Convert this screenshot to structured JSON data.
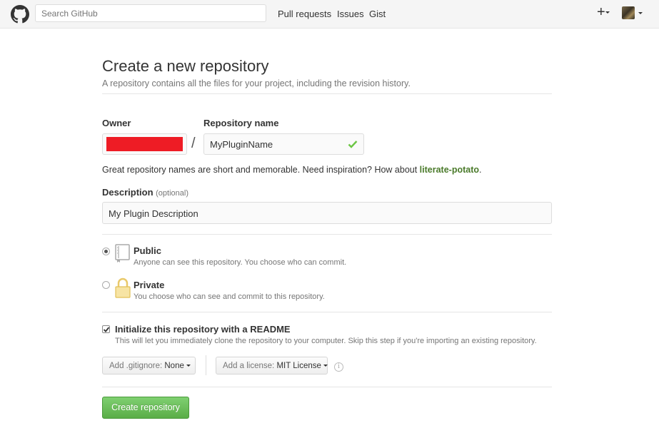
{
  "header": {
    "search_placeholder": "Search GitHub",
    "nav": [
      "Pull requests",
      "Issues",
      "Gist"
    ],
    "plus_label": "+"
  },
  "page": {
    "title": "Create a new repository",
    "subtitle": "A repository contains all the files for your project, including the revision history."
  },
  "form": {
    "owner_label": "Owner",
    "repo_label": "Repository name",
    "slash": "/",
    "repo_value": "MyPluginName",
    "hint_prefix": "Great repository names are short and memorable. Need inspiration? How about ",
    "hint_suggestion": "literate-potato",
    "hint_suffix": ".",
    "description_label": "Description",
    "description_optional": "(optional)",
    "description_value": "My Plugin Description"
  },
  "visibility": {
    "selected": "public",
    "public_title": "Public",
    "public_desc": "Anyone can see this repository. You choose who can commit.",
    "private_title": "Private",
    "private_desc": "You choose who can see and commit to this repository."
  },
  "init": {
    "checked": true,
    "title": "Initialize this repository with a README",
    "desc": "This will let you immediately clone the repository to your computer. Skip this step if you're importing an existing repository."
  },
  "options": {
    "gitignore_label": "Add .gitignore:",
    "gitignore_value": "None",
    "license_label": "Add a license:",
    "license_value": "MIT License",
    "info_symbol": "i"
  },
  "submit_label": "Create repository",
  "colors": {
    "header_bg": "#f5f5f5",
    "owner_redaction": "#ee1c25",
    "valid_check": "#6cc644",
    "suggestion": "#4a7a2a",
    "create_button": "#6cc644"
  }
}
